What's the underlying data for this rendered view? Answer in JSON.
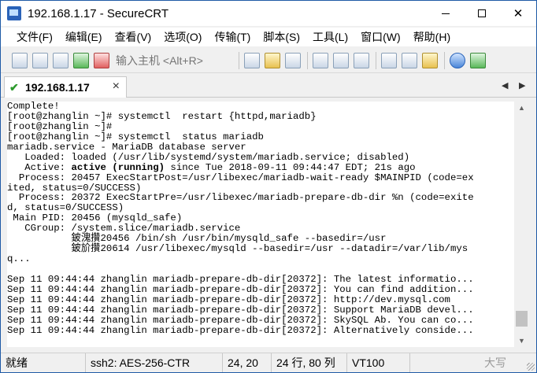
{
  "window": {
    "title": "192.168.1.17 - SecureCRT",
    "controls": {
      "minimize": "—",
      "maximize": "☐",
      "close": "✕"
    }
  },
  "menu": {
    "items": [
      "文件(F)",
      "编辑(E)",
      "查看(V)",
      "选项(O)",
      "传输(T)",
      "脚本(S)",
      "工具(L)",
      "窗口(W)",
      "帮助(H)"
    ]
  },
  "toolbar": {
    "host_placeholder": "输入主机 <Alt+R>",
    "icons_left": [
      "connect-icon",
      "quick-connect-icon",
      "connect-in-tab-icon",
      "reconnect-icon",
      "disconnect-icon"
    ],
    "icons_right": [
      "copy-icon",
      "paste-icon",
      "find-icon",
      "print-icon",
      "print-setup-icon",
      "print-screen-icon",
      "session-options-icon",
      "global-options-icon",
      "keymap-icon",
      "help-icon",
      "sftp-icon"
    ]
  },
  "tab": {
    "label": "192.168.1.17",
    "close": "×",
    "nav_prev": "◀",
    "nav_next": "▶",
    "status_color": "#2c9a2c"
  },
  "terminal": {
    "lines": [
      "Complete!",
      "[root@zhanglin ~]# systemctl  restart {httpd,mariadb}",
      "[root@zhanglin ~]#",
      "[root@zhanglin ~]# systemctl  status mariadb",
      "mariadb.service - MariaDB database server",
      "   Loaded: loaded (/usr/lib/systemd/system/mariadb.service; disabled)",
      "   Active: ",
      "  Process: 20457 ExecStartPost=/usr/libexec/mariadb-wait-ready $MAINPID (code=ex",
      "ited, status=0/SUCCESS)",
      "  Process: 20372 ExecStartPre=/usr/libexec/mariadb-prepare-db-dir %n (code=exite",
      "d, status=0/SUCCESS)",
      " Main PID: 20456 (mysqld_safe)",
      "   CGroup: /system.slice/mariadb.service",
      "           鈹溾攢20456 /bin/sh /usr/bin/mysqld_safe --basedir=/usr",
      "           鈹斺攢20614 /usr/libexec/mysqld --basedir=/usr --datadir=/var/lib/mys",
      "q...",
      "",
      "Sep 11 09:44:44 zhanglin mariadb-prepare-db-dir[20372]: The latest informatio...",
      "Sep 11 09:44:44 zhanglin mariadb-prepare-db-dir[20372]: You can find addition...",
      "Sep 11 09:44:44 zhanglin mariadb-prepare-db-dir[20372]: http://dev.mysql.com",
      "Sep 11 09:44:44 zhanglin mariadb-prepare-db-dir[20372]: Support MariaDB devel...",
      "Sep 11 09:44:44 zhanglin mariadb-prepare-db-dir[20372]: SkySQL Ab. You can co...",
      "Sep 11 09:44:44 zhanglin mariadb-prepare-db-dir[20372]: Alternatively conside..."
    ],
    "active_status": "active (running)",
    "active_rest": " since Tue 2018-09-11 09:44:47 EDT; 21s ago"
  },
  "scrollbar": {
    "up": "▲",
    "down": "▼",
    "position_fraction": 0.9
  },
  "status": {
    "ready": "就绪",
    "cipher": "ssh2: AES-256-CTR",
    "cursor": "24,  20",
    "size": "24 行, 80 列",
    "emulation": "VT100",
    "caps": "大写"
  }
}
